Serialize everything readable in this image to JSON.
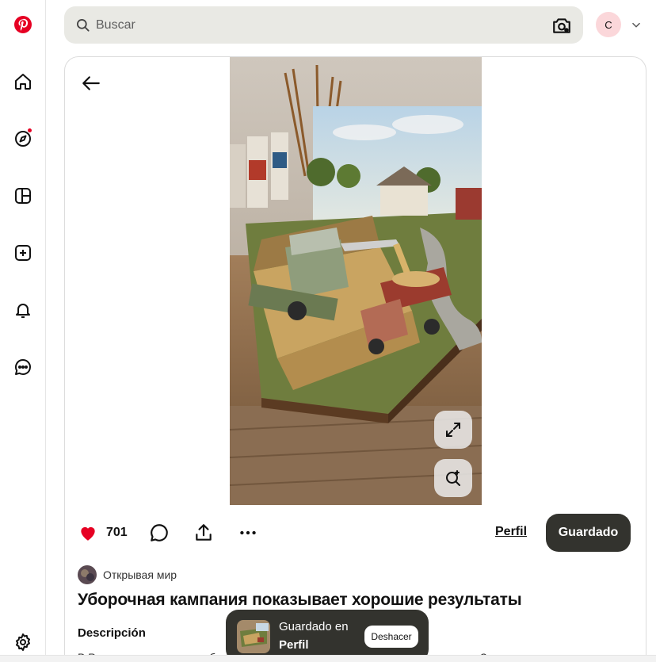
{
  "search": {
    "placeholder": "Buscar"
  },
  "user": {
    "initial": "C"
  },
  "pin": {
    "likes": "701",
    "profile_link": "Perfil",
    "save_label": "Guardado",
    "author": "Открывая мир",
    "title": "Уборочная кампания показывает хорошие результаты",
    "description_heading": "Descripción",
    "description_text": "В России продолжается сбор урожая. Уборочные работы проходят уверенно. Зерновые уже"
  },
  "toast": {
    "line1": "Guardado en",
    "line2": "Perfil",
    "undo_label": "Deshacer"
  },
  "colors": {
    "brand": "#e60023",
    "dark_button": "#33332e",
    "search_bg": "#e9e9e4"
  }
}
